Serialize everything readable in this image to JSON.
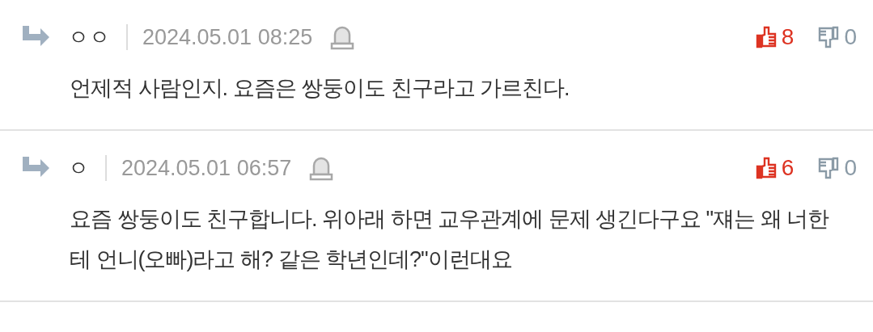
{
  "comments": [
    {
      "author": "ㅇㅇ",
      "date": "2024.05.01 08:25",
      "likes": "8",
      "dislikes": "0",
      "text": "언제적 사람인지. 요즘은 쌍둥이도 친구라고 가르친다."
    },
    {
      "author": "ㅇ",
      "date": "2024.05.01 06:57",
      "likes": "6",
      "dislikes": "0",
      "text": "요즘 쌍둥이도 친구합니다. 위아래 하면 교우관계에 문제 생긴다구요 \"쟤는 왜 너한테 언니(오빠)라고 해? 같은 학년인데?\"이런대요"
    }
  ]
}
